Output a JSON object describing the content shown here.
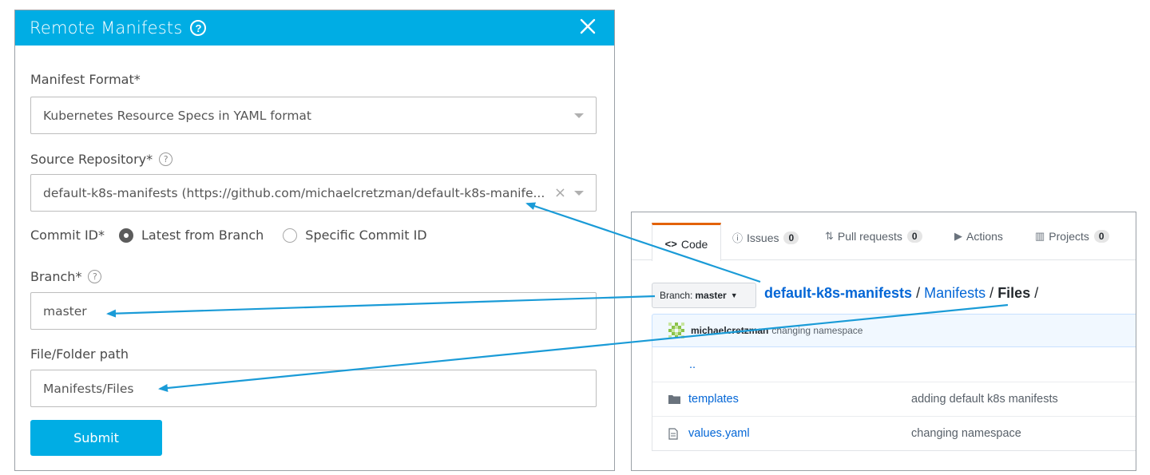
{
  "modal": {
    "title": "Remote Manifests",
    "help_glyph": "?",
    "close_glyph": "✕",
    "manifest_format": {
      "label": "Manifest Format*",
      "value": "Kubernetes Resource Specs in YAML format"
    },
    "source_repository": {
      "label": "Source Repository*",
      "value": "default-k8s-manifests (https://github.com/michaelcretzman/default-k8s-manife...",
      "clear_glyph": "×"
    },
    "commit_id": {
      "label": "Commit ID*",
      "options": [
        "Latest from Branch",
        "Specific Commit ID"
      ],
      "selected": "Latest from Branch"
    },
    "branch": {
      "label": "Branch*",
      "value": "master"
    },
    "file_path": {
      "label": "File/Folder path",
      "value": "Manifests/Files"
    },
    "submit_label": "Submit"
  },
  "github": {
    "tabs": [
      {
        "label": "Code",
        "icon": "code-icon",
        "glyph": "<>"
      },
      {
        "label": "Issues",
        "icon": "issue-icon",
        "glyph": "ⓘ",
        "count": "0"
      },
      {
        "label": "Pull requests",
        "icon": "pull-request-icon",
        "glyph": "⇅",
        "count": "0"
      },
      {
        "label": "Actions",
        "icon": "play-icon",
        "glyph": "▶"
      },
      {
        "label": "Projects",
        "icon": "project-icon",
        "glyph": "▥",
        "count": "0"
      }
    ],
    "branch_prefix": "Branch:",
    "branch_name": "master",
    "breadcrumb": {
      "repo": "default-k8s-manifests",
      "sep": "/",
      "dir": "Manifests",
      "current": "Files",
      "trailing": "/"
    },
    "latest_commit": {
      "author": "michaelcretzman",
      "message": "changing namespace"
    },
    "files": [
      {
        "name": "..",
        "message": "",
        "icon": ""
      },
      {
        "name": "templates",
        "message": "adding default k8s manifests",
        "icon": "folder-icon"
      },
      {
        "name": "values.yaml",
        "message": "changing namespace",
        "icon": "file-icon"
      }
    ]
  },
  "colors": {
    "accent": "#00ade4",
    "arrow": "#1a9bd7",
    "link": "#0366d6",
    "github_tab_active": "#e36209"
  }
}
